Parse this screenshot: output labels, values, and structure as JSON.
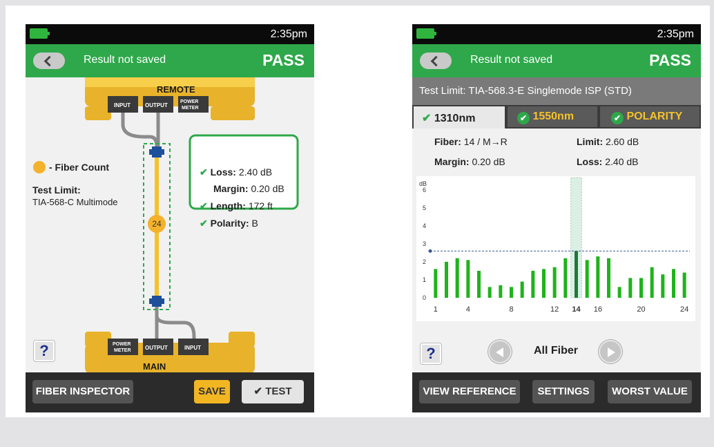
{
  "colors": {
    "accent_green": "#2ea84a",
    "fiber_yellow": "#f4c22b",
    "bar_green": "#1fb31b",
    "connector_blue": "#1d4f9a",
    "save_yellow": "#f2b623"
  },
  "left": {
    "status": {
      "time": "2:35pm"
    },
    "header": {
      "title": "Result not saved",
      "verdict": "PASS"
    },
    "remote": {
      "title": "REMOTE",
      "ports": [
        "INPUT",
        "OUTPUT",
        "POWER METER"
      ]
    },
    "main": {
      "title": "MAIN",
      "ports": [
        "POWER METER",
        "OUTPUT",
        "INPUT"
      ]
    },
    "legend": {
      "label": "- Fiber Count"
    },
    "test_limit": {
      "label": "Test Limit:",
      "value": "TIA-568-C Multimode"
    },
    "fiber_count": "24",
    "results": {
      "loss": {
        "label": "Loss:",
        "value": "2.40 dB"
      },
      "margin": {
        "label": "Margin:",
        "value": "0.20 dB"
      },
      "length": {
        "label": "Length:",
        "value": "172 ft"
      },
      "polarity": {
        "label": "Polarity:",
        "value": "B"
      }
    },
    "help": "?",
    "footer": {
      "fiber_inspector": "FIBER INSPECTOR",
      "save": "SAVE",
      "test": "TEST"
    }
  },
  "right": {
    "status": {
      "time": "2:35pm"
    },
    "header": {
      "title": "Result not saved",
      "verdict": "PASS"
    },
    "test_limit": "Test Limit: TIA-568.3-E Singlemode ISP (STD)",
    "tabs": [
      "1310nm",
      "1550nm",
      "POLARITY"
    ],
    "details": {
      "fiber": {
        "label": "Fiber:",
        "value": "14 / M→R"
      },
      "limit": {
        "label": "Limit:",
        "value": "2.60 dB"
      },
      "margin": {
        "label": "Margin:",
        "value": "0.20 dB"
      },
      "loss": {
        "label": "Loss:",
        "value": "2.40 dB"
      }
    },
    "help": "?",
    "nav_label": "All Fiber",
    "footer": {
      "view_reference": "VIEW REFERENCE",
      "settings": "SETTINGS",
      "worst_value": "WORST VALUE"
    }
  },
  "chart_data": {
    "type": "bar",
    "ylabel": "dB",
    "y_ticks": [
      "0",
      "1",
      "2",
      "3",
      "4",
      "5",
      "6"
    ],
    "ylim": [
      0,
      6.3
    ],
    "x_ticks": [
      "1",
      "4",
      "8",
      "12",
      "14",
      "16",
      "20",
      "24"
    ],
    "x_tick_positions": [
      1,
      4,
      8,
      12,
      14,
      16,
      20,
      24
    ],
    "categories": [
      1,
      2,
      3,
      4,
      5,
      6,
      7,
      8,
      9,
      10,
      11,
      12,
      13,
      14,
      15,
      16,
      17,
      18,
      19,
      20,
      21,
      22,
      23,
      24
    ],
    "values": [
      1.6,
      2.0,
      2.2,
      2.1,
      1.5,
      0.6,
      0.7,
      0.6,
      0.9,
      1.5,
      1.6,
      1.7,
      2.2,
      2.6,
      2.1,
      2.3,
      2.2,
      0.6,
      1.1,
      1.1,
      1.7,
      1.3,
      1.6,
      1.4
    ],
    "highlighted_fiber": 14,
    "limit_line": 2.6
  }
}
